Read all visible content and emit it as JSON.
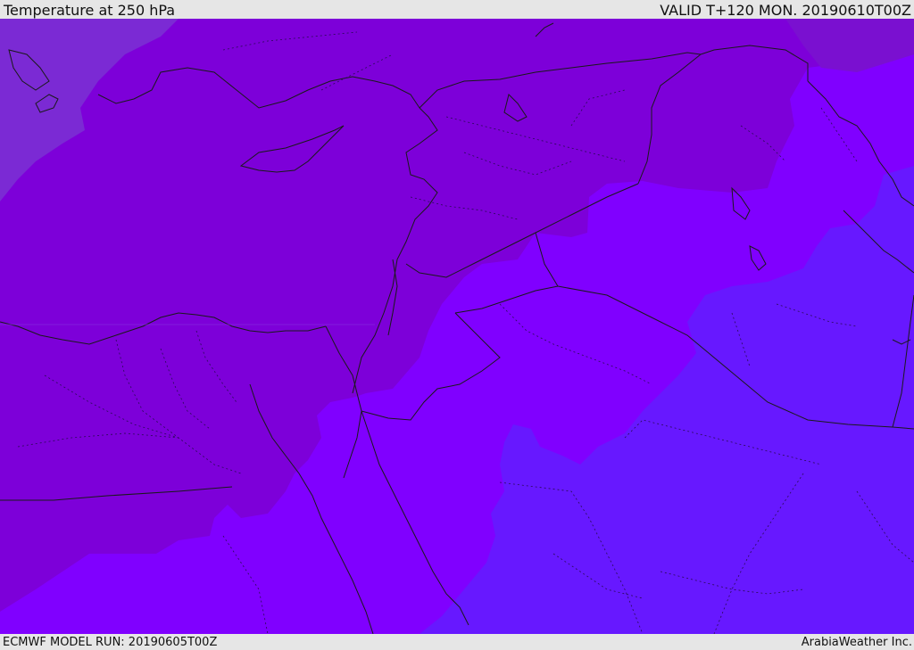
{
  "header": {
    "title": "Temperature at 250 hPa",
    "valid": "VALID T+120 MON. 20190610T00Z"
  },
  "footer": {
    "model_run": "ECMWF MODEL RUN: 20190605T00Z",
    "credit": "ArabiaWeather Inc."
  },
  "colors": {
    "band_warm": "#7b2ad4",
    "band_mid": "#7d00d9",
    "band_cool": "#8000ff",
    "band_cold": "#6718ff",
    "land_border": "#1a1a1a",
    "admin_border": "#2a0a55"
  }
}
